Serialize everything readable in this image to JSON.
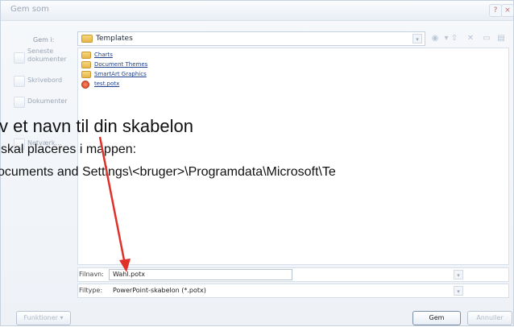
{
  "window": {
    "title": "Gem som",
    "lookin_label": "Gem i:",
    "lookin_value": "Templates"
  },
  "places": [
    {
      "label": "Seneste dokumenter"
    },
    {
      "label": "Skrivebord"
    },
    {
      "label": "Dokumenter"
    },
    {
      "label": "Netværk..."
    }
  ],
  "files": [
    {
      "name": "Charts",
      "type": "folder"
    },
    {
      "name": "Document Themes",
      "type": "folder"
    },
    {
      "name": "SmartArt Graphics",
      "type": "folder"
    },
    {
      "name": "test.potx",
      "type": "potx"
    }
  ],
  "overlay": {
    "line1": "v et navn til din skabelon",
    "line2": "skal placeres i mappen:",
    "line3": "ocuments and Settings\\<bruger>\\Programdata\\Microsoft\\Te"
  },
  "fields": {
    "filename_label": "Filnavn:",
    "filename_value": "Wahl.potx",
    "filetype_label": "Filtype:",
    "filetype_value": "PowerPoint-skabelon (*.potx)"
  },
  "buttons": {
    "tools": "Funktioner",
    "save": "Gem",
    "cancel": "Annuller"
  },
  "colors": {
    "arrow": "#e0302a",
    "accent": "#1d3f8a"
  }
}
